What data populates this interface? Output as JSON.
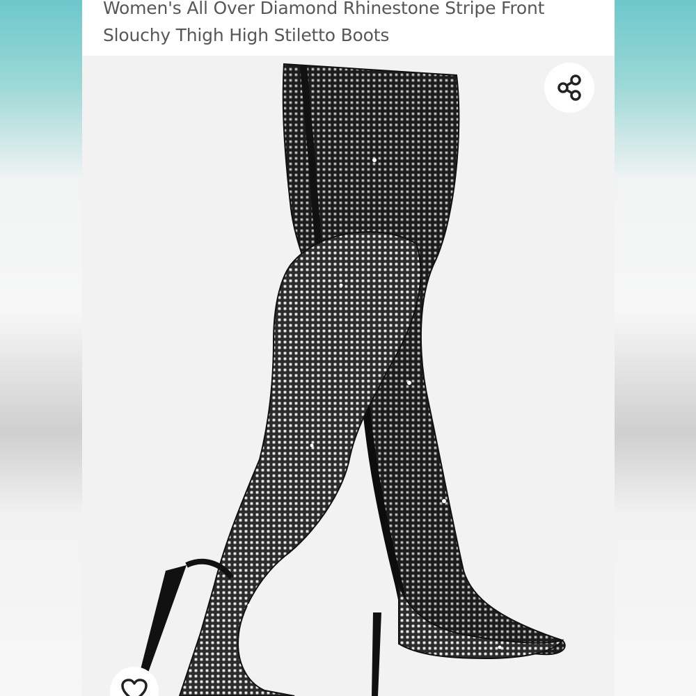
{
  "product": {
    "title": "Women's All Over Diamond Rhinestone Stripe Front Slouchy Thigh High Stiletto Boots"
  },
  "image": {
    "alt": "Women's All Over Diamond Rhinestone Stripe Front Slouchy Thigh High Stiletto Boots"
  },
  "actions": {
    "share_icon": "share-icon",
    "wishlist_icon": "heart-outline-icon"
  },
  "colors": {
    "backdrop_teal": "#6ec7cc",
    "card_bg": "#ffffff",
    "image_bg": "#f2f2f2",
    "title_text": "#575757",
    "icon_dark": "#222222",
    "boot_black": "#1a1a1a",
    "rhinestone": "#e8e8e8"
  }
}
